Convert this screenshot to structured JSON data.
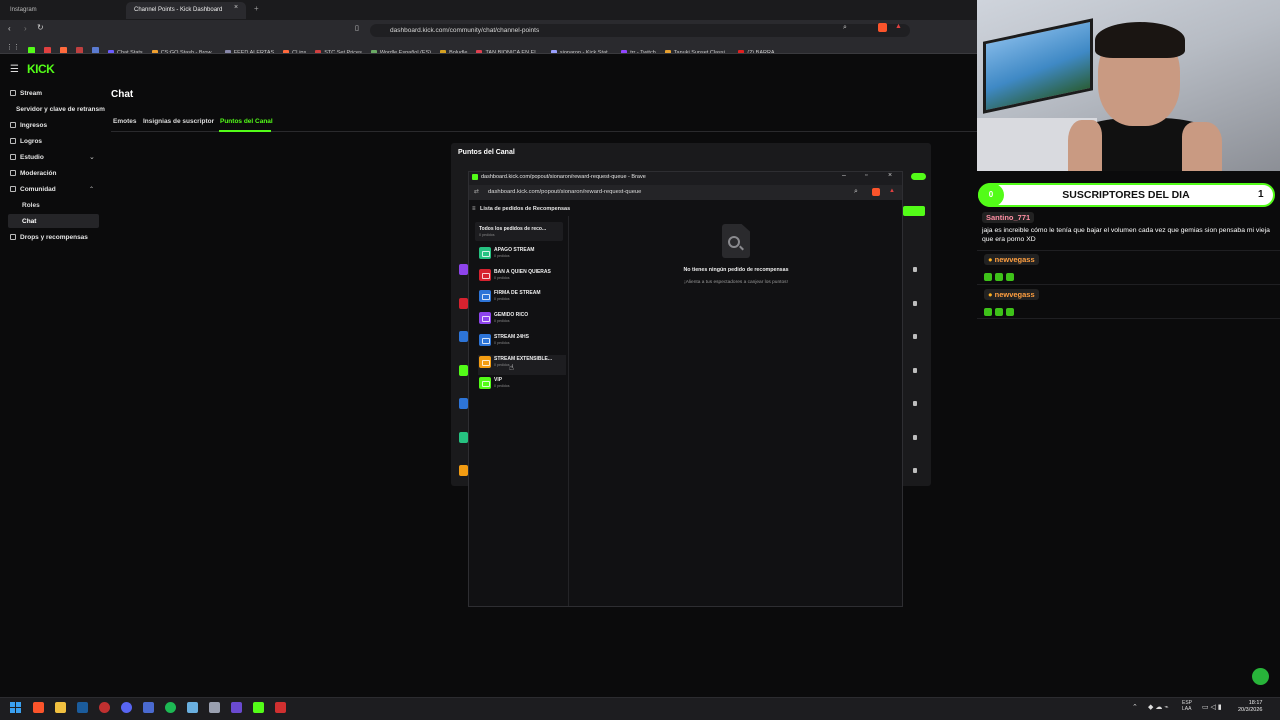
{
  "browser": {
    "tabs": [
      {
        "label": "Instagram",
        "color": "#e1306c"
      },
      {
        "label": "Channel Points - Kick Dashboard",
        "color": "#53fc18"
      }
    ],
    "url": "dashboard.kick.com/community/chat/channel-points",
    "bookmarks": [
      {
        "label": "Chat Stats",
        "color": "#6b5cff"
      },
      {
        "label": "CS:GO Stash - Brow...",
        "color": "#f0a030"
      },
      {
        "label": "FEED ALERTAS",
        "color": "#8888aa"
      },
      {
        "label": "CLips",
        "color": "#ff6a3d"
      },
      {
        "label": "STC Set Prices",
        "color": "#d04040"
      },
      {
        "label": "Wordle Español (ES)",
        "color": "#6aaa64"
      },
      {
        "label": "Boludle",
        "color": "#d4a020"
      },
      {
        "label": "TAN BIONICA EN EL...",
        "color": "#e04050"
      },
      {
        "label": "sionaron - Kick Stat...",
        "color": "#9aa0ff"
      },
      {
        "label": "trr - Twitch",
        "color": "#9146ff"
      },
      {
        "label": "Tanuki Sunset Classi...",
        "color": "#e6a030"
      },
      {
        "label": "(2) BARRA",
        "color": "#e02020"
      }
    ]
  },
  "sidebar": {
    "logo": "KICK",
    "items": [
      {
        "label": "Stream"
      },
      {
        "label": "Servidor y clave de retransm"
      },
      {
        "label": "Ingresos"
      },
      {
        "label": "Logros"
      },
      {
        "label": "Estudio"
      },
      {
        "label": "Moderación"
      },
      {
        "label": "Comunidad"
      },
      {
        "label": "Roles"
      },
      {
        "label": "Chat"
      },
      {
        "label": "Drops y recompensas"
      }
    ]
  },
  "main": {
    "title": "Chat",
    "tabs": [
      "Emotes",
      "Insignias de suscriptor",
      "Puntos del Canal"
    ],
    "active_tab": "Puntos del Canal"
  },
  "panel": {
    "title": "Puntos del Canal",
    "reward_colors": [
      "#8e44ec",
      "#d6222f",
      "#2d74d7",
      "#53fc18",
      "#2d74d7",
      "#26c281",
      "#f39c12"
    ]
  },
  "popout": {
    "window_title": "dashboard.kick.com/popout/sionaron/reward-request-queue - Brave",
    "url": "dashboard.kick.com/popout/sionaron/reward-request-queue",
    "header": "Lista de pedidos de Recompensas",
    "all_requests": {
      "title": "Todos los pedidos de reco...",
      "count": "0 pedidos"
    },
    "rewards": [
      {
        "name": "APAGO STREAM",
        "count": "0 pedidos",
        "color": "#26c281"
      },
      {
        "name": "BAN A QUIEN QUIERAS",
        "count": "0 pedidos",
        "color": "#d6222f"
      },
      {
        "name": "FIRMA DE STREAM",
        "count": "0 pedidos",
        "color": "#2d74d7"
      },
      {
        "name": "GEMIDO RICO",
        "count": "0 pedidos",
        "color": "#8e44ec"
      },
      {
        "name": "STREAM 24HS",
        "count": "0 pedidos",
        "color": "#2d74d7"
      },
      {
        "name": "STREAM EXTENSIBLE...",
        "count": "0 pedidos",
        "color": "#f39c12"
      },
      {
        "name": "VIP",
        "count": "0 pedidos",
        "color": "#53fc18"
      }
    ],
    "empty_title": "No tienes ningún pedido de recompensas",
    "empty_subtitle": "¡Alienta a tus espectadores a canjear los puntos!"
  },
  "overlay": {
    "subs_title": "SUSCRIPTORES DEL DIA",
    "subs_left": "0",
    "subs_right": "1",
    "messages": [
      {
        "user": "Santino_771",
        "user_color": "#ff8fa3",
        "text": "jaja es increible cómo le tenía que bajar el volumen cada vez que gemias sion pensaba mi vieja que era porno XD",
        "emotes": 0
      },
      {
        "user": "newvegass",
        "user_color": "#ff9f40",
        "text": "",
        "emotes": 3
      },
      {
        "user": "newvegass",
        "user_color": "#ff9f40",
        "text": "",
        "emotes": 3
      }
    ]
  },
  "taskbar": {
    "lang": "ESP\nLAA",
    "time": "18:17",
    "date": "20/3/2026"
  }
}
